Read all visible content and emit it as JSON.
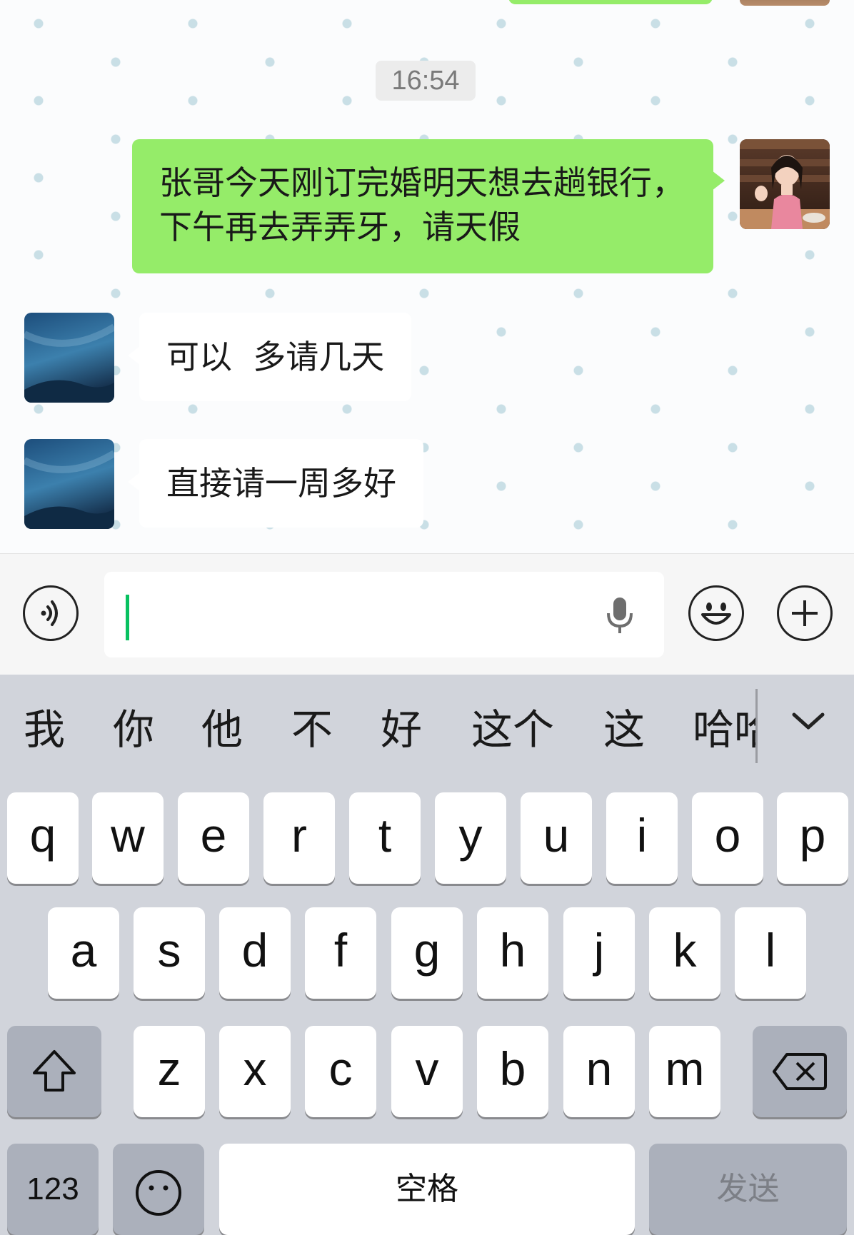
{
  "chat": {
    "timestamp": "16:54",
    "messages": [
      {
        "from": "me",
        "text": "张哥今天刚订完婚明天想去趟银行，下午再去弄弄牙，请天假"
      },
      {
        "from": "other",
        "text": "可以  多请几天"
      },
      {
        "from": "other",
        "text": "直接请一周多好"
      }
    ]
  },
  "input": {
    "value": "",
    "icons": [
      "voice-icon",
      "microphone-icon",
      "emoji-icon",
      "add-icon"
    ],
    "accent": "#07c160"
  },
  "keyboard": {
    "candidates": [
      "我",
      "你",
      "他",
      "不",
      "好",
      "这个",
      "这",
      "哈哈"
    ],
    "rows": [
      [
        "q",
        "w",
        "e",
        "r",
        "t",
        "y",
        "u",
        "i",
        "o",
        "p"
      ],
      [
        "a",
        "s",
        "d",
        "f",
        "g",
        "h",
        "j",
        "k",
        "l"
      ],
      [
        "z",
        "x",
        "c",
        "v",
        "b",
        "n",
        "m"
      ]
    ],
    "bottom_row": {
      "numbers": "123",
      "space": "空格",
      "send": "发送"
    }
  },
  "colors": {
    "my_bubble": "#95ec69",
    "other_bubble": "#ffffff",
    "keyboard_bg": "#d1d4db"
  }
}
